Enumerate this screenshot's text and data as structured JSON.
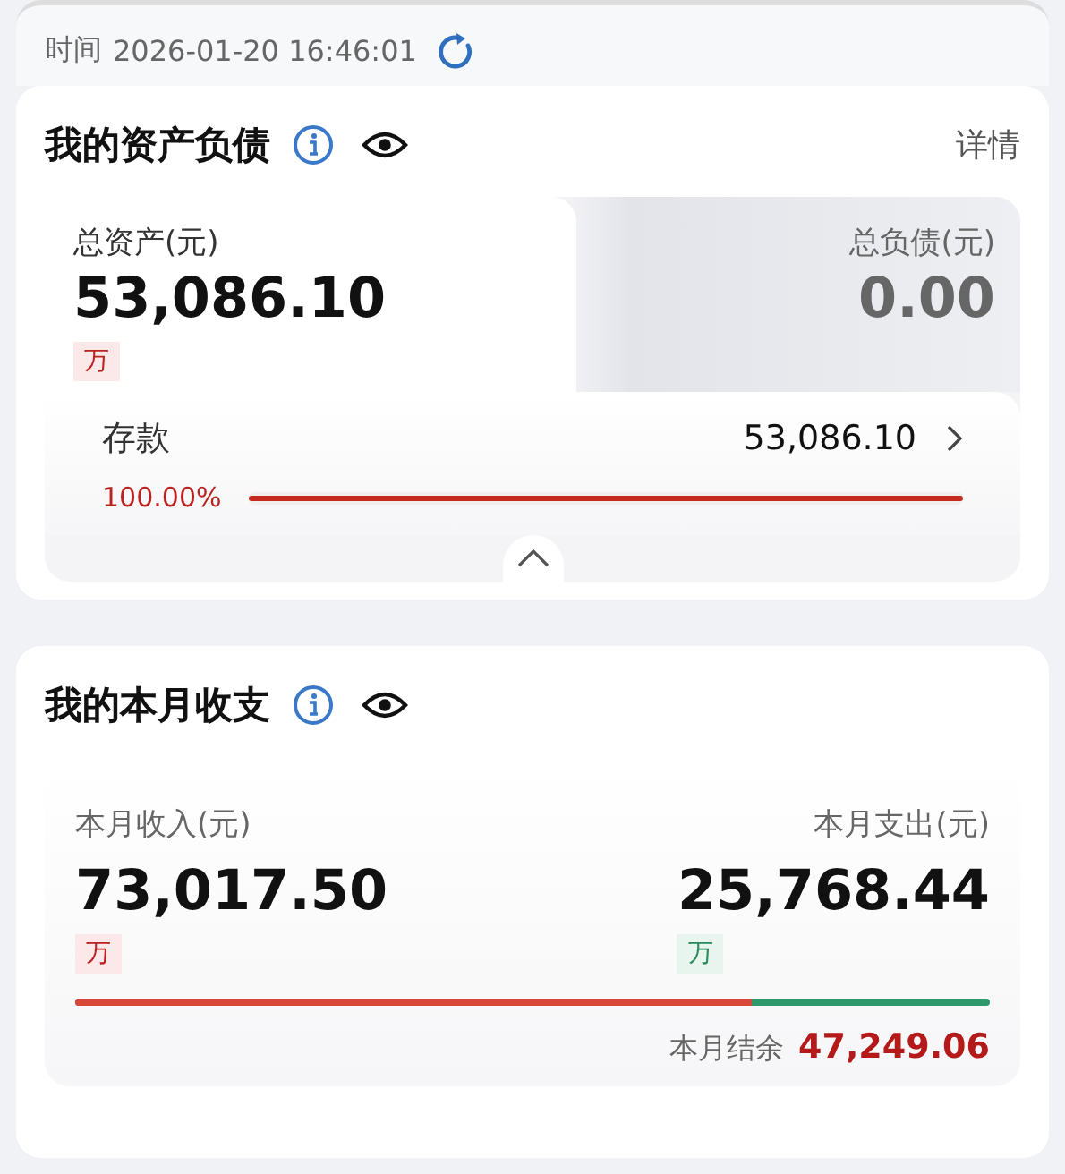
{
  "time_bar": {
    "label": "时间",
    "value": "2026-01-20 16:46:01"
  },
  "assets": {
    "title": "我的资产负债",
    "detail_link": "详情",
    "total_assets_label": "总资产(元)",
    "total_assets": "53,086.10",
    "unit_badge": "万",
    "total_liabilities_label": "总负债(元)",
    "total_liabilities": "0.00",
    "items": [
      {
        "name": "存款",
        "amount": "53,086.10",
        "percent": "100.00%",
        "level": 1.0
      }
    ]
  },
  "monthly": {
    "title": "我的本月收支",
    "income_label": "本月收入(元)",
    "income": "73,017.50",
    "income_unit": "万",
    "expense_label": "本月支出(元)",
    "expense": "25,768.44",
    "expense_unit": "万",
    "income_share": {
      "level": 0.739
    },
    "balance_label": "本月结余",
    "balance": "47,249.06"
  }
}
